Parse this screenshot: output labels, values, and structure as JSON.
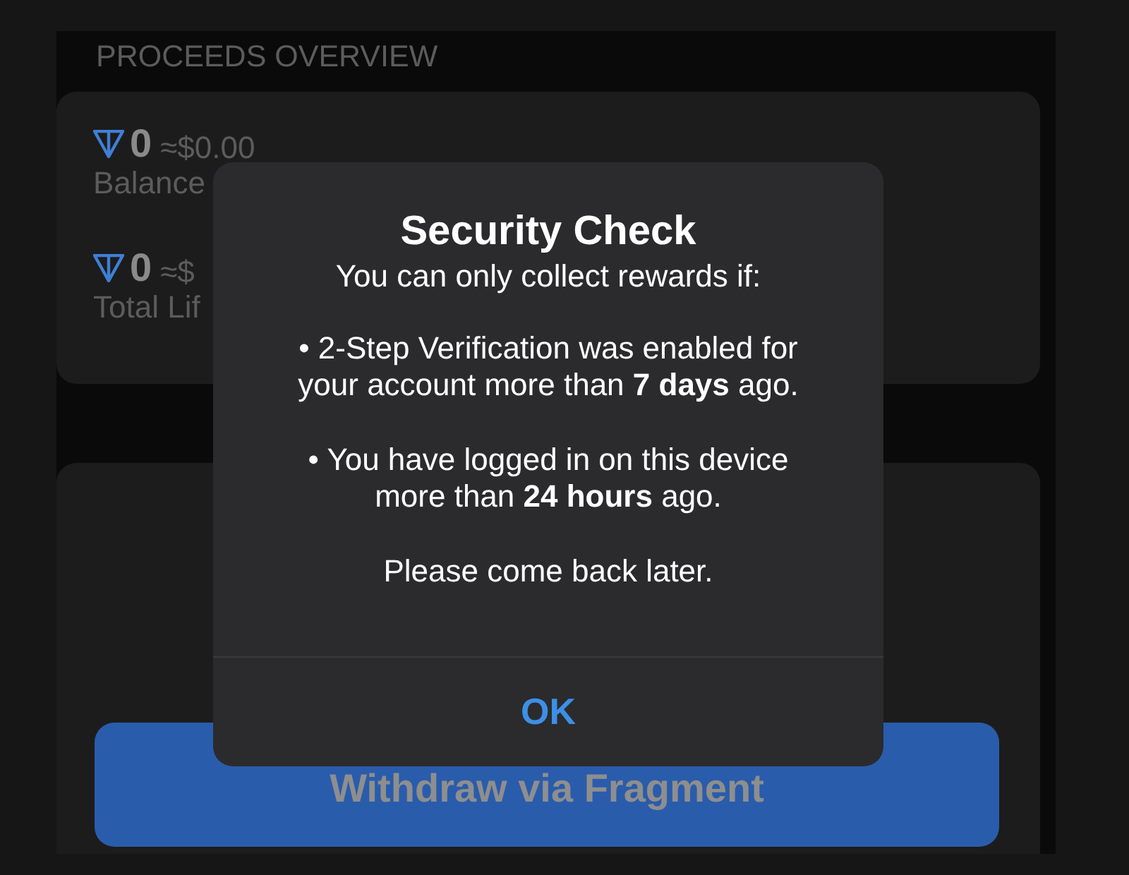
{
  "section_header": "PROCEEDS OVERVIEW",
  "stats": [
    {
      "amount": "0",
      "fiat": "≈$0.00",
      "label": "Balance"
    },
    {
      "amount": "0",
      "fiat": "≈$",
      "label": "Total Lif"
    }
  ],
  "withdraw_button": "Withdraw via Fragment",
  "dialog": {
    "title": "Security Check",
    "paragraphs": [
      "You can only collect rewards if:",
      "• 2-Step Verification was enabled for your account more than **7 days** ago.",
      "• You have logged in on this device more than **24 hours** ago.",
      "Please come back later."
    ],
    "button": "OK"
  }
}
